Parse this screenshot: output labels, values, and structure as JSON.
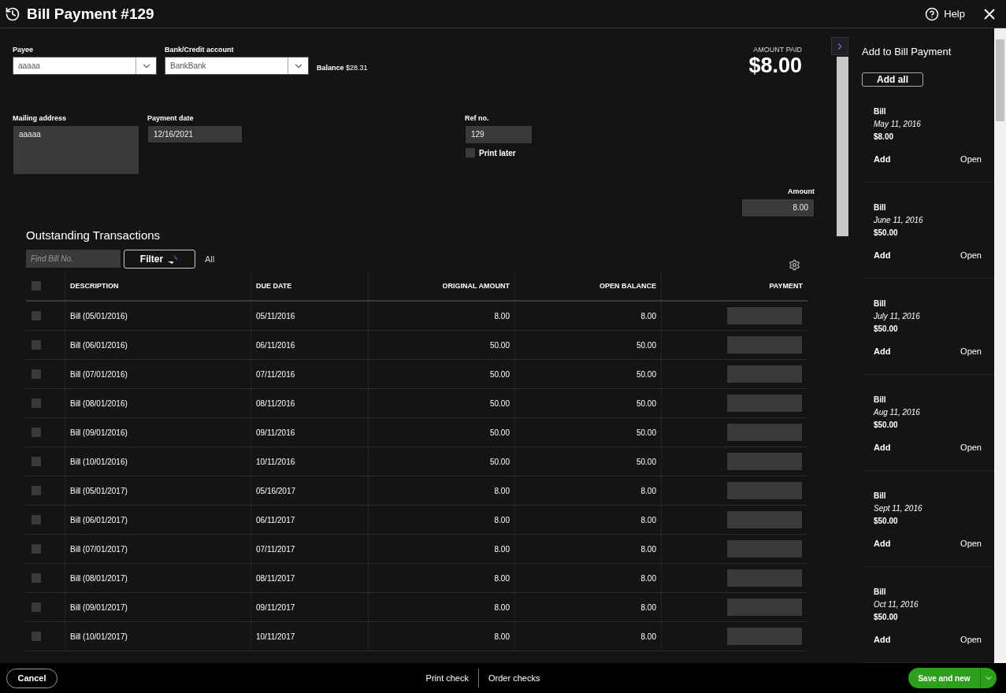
{
  "window": {
    "title": "Bill Payment #129",
    "help": "Help"
  },
  "payee": {
    "label": "Payee",
    "value": "aaaaa"
  },
  "bank_account": {
    "label": "Bank/Credit account",
    "value": "BankBank",
    "balance_label": "Balance",
    "balance": "$28.31"
  },
  "amount_paid": {
    "label": "AMOUNT PAID",
    "value": "$8.00"
  },
  "mailing_address": {
    "label": "Mailing address",
    "value": "aaaaa"
  },
  "payment_date": {
    "label": "Payment date",
    "value": "12/16/2021"
  },
  "ref_no": {
    "label": "Ref no.",
    "value": "129"
  },
  "print_later": {
    "label": "Print later",
    "checked": false
  },
  "amount": {
    "label": "Amount",
    "value": "8.00"
  },
  "outstanding": {
    "title": "Outstanding Transactions",
    "search": {
      "placeholder": "Find Bill No."
    },
    "filter": "Filter",
    "filter_value": "All",
    "select_all": {
      "checked": false
    },
    "columns": [
      "DESCRIPTION",
      "DUE DATE",
      "ORIGINAL AMOUNT",
      "OPEN BALANCE",
      "PAYMENT"
    ],
    "rows": [
      {
        "checked": false,
        "description": "Bill (05/01/2016)",
        "due_date": "05/11/2016",
        "original_amount": "8.00",
        "open_balance": "8.00"
      },
      {
        "checked": false,
        "description": "Bill (06/01/2016)",
        "due_date": "06/11/2016",
        "original_amount": "50.00",
        "open_balance": "50.00"
      },
      {
        "checked": false,
        "description": "Bill (07/01/2016)",
        "due_date": "07/11/2016",
        "original_amount": "50.00",
        "open_balance": "50.00"
      },
      {
        "checked": false,
        "description": "Bill (08/01/2016)",
        "due_date": "08/11/2016",
        "original_amount": "50.00",
        "open_balance": "50.00"
      },
      {
        "checked": false,
        "description": "Bill (09/01/2016)",
        "due_date": "09/11/2016",
        "original_amount": "50.00",
        "open_balance": "50.00"
      },
      {
        "checked": false,
        "description": "Bill (10/01/2016)",
        "due_date": "10/11/2016",
        "original_amount": "50.00",
        "open_balance": "50.00"
      },
      {
        "checked": false,
        "description": "Bill (05/01/2017)",
        "due_date": "05/16/2017",
        "original_amount": "8.00",
        "open_balance": "8.00"
      },
      {
        "checked": false,
        "description": "Bill (06/01/2017)",
        "due_date": "06/11/2017",
        "original_amount": "8.00",
        "open_balance": "8.00"
      },
      {
        "checked": false,
        "description": "Bill (07/01/2017)",
        "due_date": "07/11/2017",
        "original_amount": "8.00",
        "open_balance": "8.00"
      },
      {
        "checked": false,
        "description": "Bill (08/01/2017)",
        "due_date": "08/11/2017",
        "original_amount": "8.00",
        "open_balance": "8.00"
      },
      {
        "checked": false,
        "description": "Bill (09/01/2017)",
        "due_date": "09/11/2017",
        "original_amount": "8.00",
        "open_balance": "8.00"
      },
      {
        "checked": false,
        "description": "Bill (10/01/2017)",
        "due_date": "10/11/2017",
        "original_amount": "8.00",
        "open_balance": "8.00"
      }
    ]
  },
  "side_panel": {
    "title": "Add to Bill Payment",
    "add_all": "Add all",
    "items": [
      {
        "type": "Bill",
        "date": "May 11, 2016",
        "amount": "$8.00",
        "add": "Add",
        "open": "Open"
      },
      {
        "type": "Bill",
        "date": "June 11, 2016",
        "amount": "$50.00",
        "add": "Add",
        "open": "Open"
      },
      {
        "type": "Bill",
        "date": "July 11, 2016",
        "amount": "$50.00",
        "add": "Add",
        "open": "Open"
      },
      {
        "type": "Bill",
        "date": "Aug 11, 2016",
        "amount": "$50.00",
        "add": "Add",
        "open": "Open"
      },
      {
        "type": "Bill",
        "date": "Sept 11, 2016",
        "amount": "$50.00",
        "add": "Add",
        "open": "Open"
      },
      {
        "type": "Bill",
        "date": "Oct 11, 2016",
        "amount": "$50.00",
        "add": "Add",
        "open": "Open"
      }
    ]
  },
  "footer": {
    "cancel": "Cancel",
    "print_check": "Print check",
    "order_checks": "Order checks",
    "save": "Save and new"
  }
}
